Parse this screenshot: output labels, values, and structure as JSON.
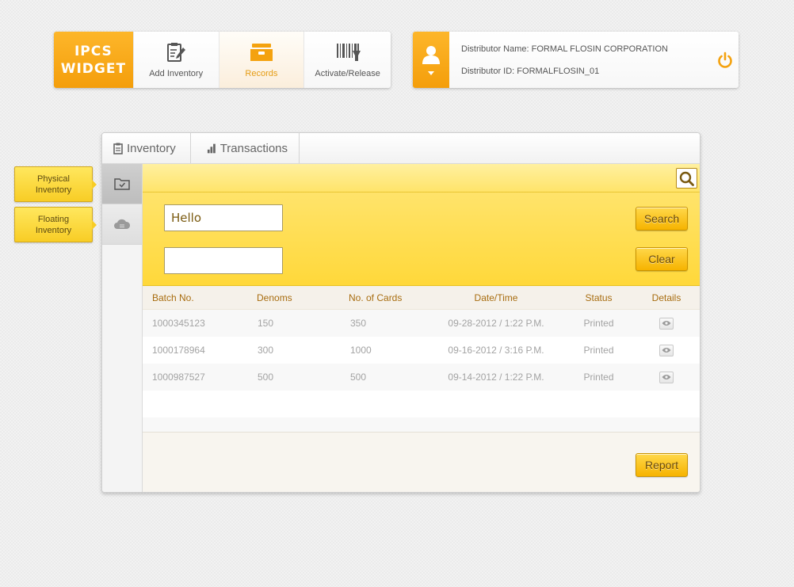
{
  "brand": {
    "line1": "IPCS",
    "line2": "WIDGET"
  },
  "toolbar": [
    {
      "label": "Add Inventory",
      "icon": "clipboard-edit-icon"
    },
    {
      "label": "Records",
      "icon": "records-drawer-icon"
    },
    {
      "label": "Activate/Release",
      "icon": "barcode-icon"
    }
  ],
  "distributor": {
    "name_label": "Distributor Name: FORMAL  FLOSIN CORPORATION",
    "id_label": "Distributor ID: FORMALFLOSIN_01",
    "avatar_icon": "user-icon",
    "power_icon": "power-icon"
  },
  "tabs": [
    {
      "label": "Inventory",
      "icon": "clipboard-icon"
    },
    {
      "label": "Transactions",
      "icon": "bar-chart-icon"
    }
  ],
  "side_tags": [
    {
      "label_line1": "Physical",
      "label_line2": "Inventory"
    },
    {
      "label_line1": "Floating",
      "label_line2": "Inventory"
    }
  ],
  "filter": {
    "input1_value": "Hello",
    "input2_value": "",
    "search_label": "Search",
    "clear_label": "Clear"
  },
  "table": {
    "headers": [
      "Batch No.",
      "Denoms",
      "No. of Cards",
      "Date/Time",
      "Status",
      "Details"
    ],
    "rows": [
      {
        "batch": "1000345123",
        "denom": "150",
        "cards": "350",
        "datetime": "09-28-2012 / 1:22 P.M.",
        "status": "Printed"
      },
      {
        "batch": "1000178964",
        "denom": "300",
        "cards": "1000",
        "datetime": "09-16-2012 / 3:16 P.M.",
        "status": "Printed"
      },
      {
        "batch": "1000987527",
        "denom": "500",
        "cards": "500",
        "datetime": "09-14-2012 / 1:22 P.M.",
        "status": "Printed"
      }
    ]
  },
  "report_label": "Report",
  "colors": {
    "accent": "#f6a912",
    "yellow": "#ffd83a",
    "header_text": "#a86d10"
  }
}
